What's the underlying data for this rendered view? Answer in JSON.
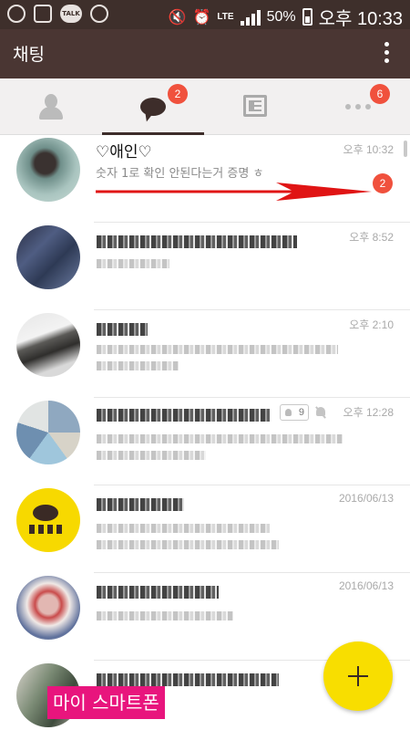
{
  "status_bar": {
    "talk_icon_text": "TALK",
    "lte_label": "LTE",
    "battery_percent": "50%",
    "time": "오후 10:33"
  },
  "app_bar": {
    "title": "채팅"
  },
  "tabs": [
    {
      "icon": "person-icon",
      "badge": ""
    },
    {
      "icon": "chat-bubble-icon",
      "badge": "2",
      "active": true
    },
    {
      "icon": "news-icon",
      "badge": ""
    },
    {
      "icon": "more-icon",
      "badge": "6"
    }
  ],
  "chats": [
    {
      "name": "♡애인♡",
      "preview": "숫자 1로 확인 안된다는거 증명 ㅎ",
      "time": "오후 10:32",
      "unread": "2"
    },
    {
      "name": "",
      "preview": "",
      "time": "오후 8:52"
    },
    {
      "name": "",
      "preview": "",
      "time": "오후 2:10"
    },
    {
      "name": "",
      "preview": "",
      "time": "오후 12:28",
      "member_count": "9"
    },
    {
      "name": "",
      "preview": "",
      "time": "2016/06/13"
    },
    {
      "name": "",
      "preview": "",
      "time": "2016/06/13"
    },
    {
      "name": "",
      "preview": "",
      "time": ""
    }
  ],
  "colors": {
    "brand_dark": "#4a3633",
    "badge_red": "#f0513d",
    "fab_yellow": "#f8de00",
    "watermark_pink": "#e8157d"
  },
  "watermark": "마이 스마트폰"
}
